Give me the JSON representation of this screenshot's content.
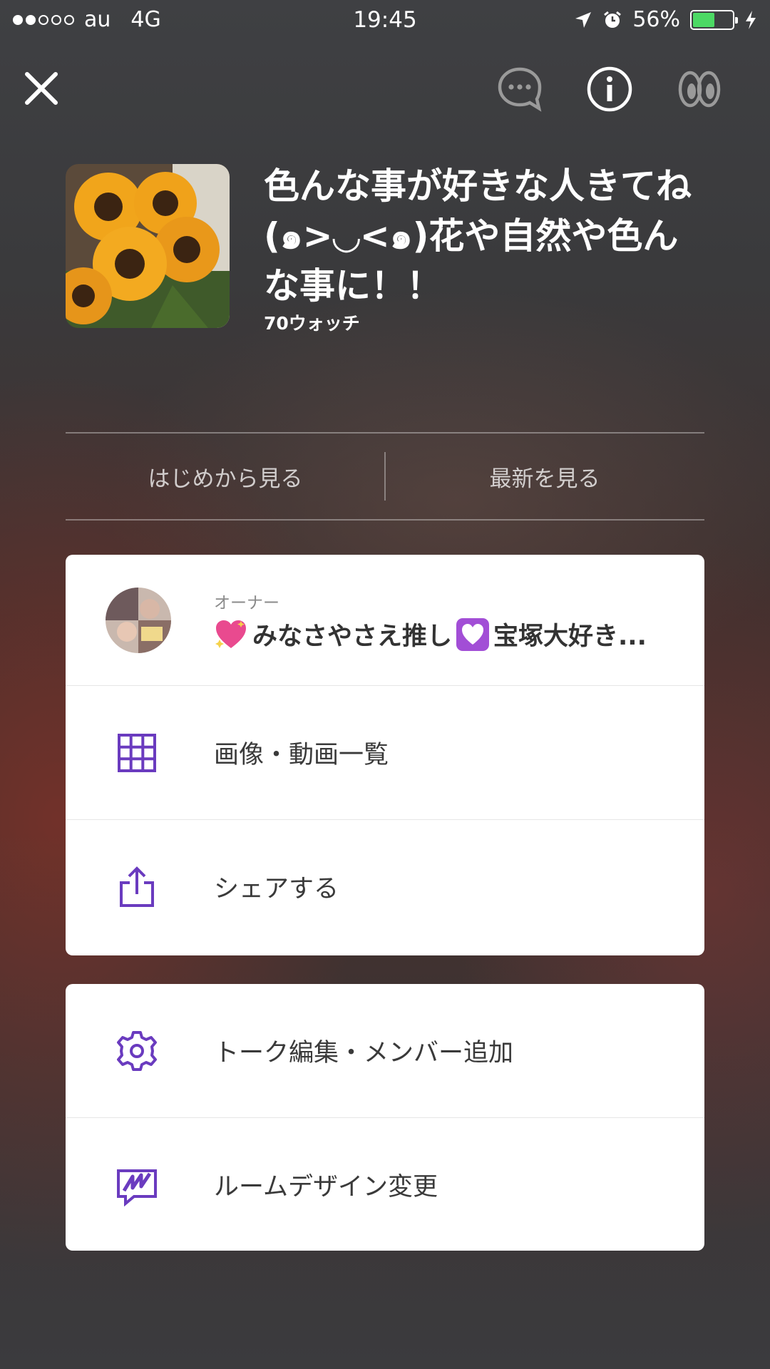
{
  "status_bar": {
    "carrier": "au",
    "network": "4G",
    "time": "19:45",
    "battery_percent": "56%",
    "battery_level": 0.56
  },
  "header": {
    "room_title": "色んな事が好きな人きてね(๑>◡<๑)花や自然や色んな事に！！",
    "watch_count": "70ウォッチ"
  },
  "view_buttons": {
    "from_start": "はじめから見る",
    "latest": "最新を見る"
  },
  "owner": {
    "caption": "オーナー",
    "name": "みなさやさえ推し",
    "name_tail": "宝塚大好き..."
  },
  "menu_primary": [
    {
      "label": "画像・動画一覧",
      "icon": "grid-icon"
    },
    {
      "label": "シェアする",
      "icon": "share-icon"
    }
  ],
  "menu_secondary": [
    {
      "label": "トーク編集・メンバー追加",
      "icon": "gear-icon"
    },
    {
      "label": "ルームデザイン変更",
      "icon": "room-design-icon"
    }
  ],
  "colors": {
    "accent": "#6a3bbf",
    "battery": "#4cd964"
  },
  "icons": [
    "close-icon",
    "chat-bubble-icon",
    "info-icon",
    "watch-eyes-icon"
  ]
}
